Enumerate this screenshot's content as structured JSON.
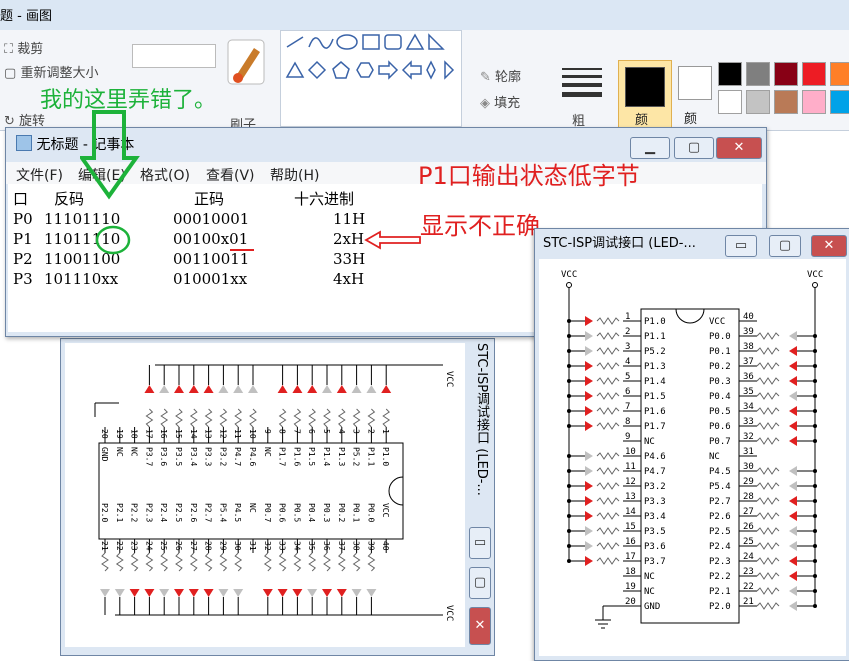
{
  "paint": {
    "title": "题 - 画图",
    "crop_label": "裁剪",
    "resize_label": "重新调整大小",
    "rotate_label": "旋转",
    "brush_label": "刷子",
    "outline_label": "轮廓",
    "fill_label": "填充",
    "size_label": "粗",
    "color1_label": "颜",
    "color2_label": "颜",
    "colors": [
      "#000000",
      "#7f7f7f",
      "#880015",
      "#ed1c24",
      "#ff7f27",
      "#ffffff",
      "#c3c3c3",
      "#b97a57",
      "#ffaec9",
      "#00a2e8"
    ]
  },
  "annotations": {
    "green_note": "我的这里弄错了。",
    "red_note_line1": "P1口输出状态低字节",
    "red_note_line2": "显示不正确"
  },
  "notepad": {
    "title": "无标题 - 记事本",
    "menu": [
      "文件(F)",
      "编辑(E)",
      "格式(O)",
      "查看(V)",
      "帮助(H)"
    ],
    "header": {
      "port": "口",
      "inverse": "反码",
      "normal": "正码",
      "hex": "十六进制"
    },
    "rows": [
      {
        "port": "P0",
        "inverse": "11101110",
        "normal": "00010001",
        "hex": "11H"
      },
      {
        "port": "P1",
        "inverse": "11011110",
        "normal": "00100x01",
        "hex": "2xH"
      },
      {
        "port": "P2",
        "inverse": "11001100",
        "normal": "00110011",
        "hex": "33H"
      },
      {
        "port": "P3",
        "inverse": "101110xx",
        "normal": "010001xx",
        "hex": "4xH"
      }
    ]
  },
  "bottom_window": {
    "title": "STC-ISP调试接口 (LED-...",
    "vcc": "VCC",
    "top_pins": [
      "20",
      "19",
      "18",
      "17",
      "16",
      "15",
      "14",
      "13",
      "12",
      "11",
      "10",
      "9",
      "8",
      "7",
      "6",
      "5",
      "4",
      "3",
      "2",
      "1"
    ],
    "top_labels": [
      "GND",
      "NC",
      "NC",
      "P3.7",
      "P3.6",
      "P3.5",
      "P3.4",
      "P3.3",
      "P3.2",
      "P4.7",
      "P4.6",
      "NC",
      "P1.7",
      "P1.6",
      "P1.5",
      "P1.4",
      "P1.3",
      "P5.2",
      "P1.1",
      "P1.0"
    ],
    "bottom_pins": [
      "21",
      "22",
      "23",
      "24",
      "25",
      "26",
      "27",
      "28",
      "29",
      "30",
      "31",
      "32",
      "33",
      "34",
      "35",
      "36",
      "37",
      "38",
      "39",
      "40"
    ],
    "bottom_labels": [
      "P2.0",
      "P2.1",
      "P2.2",
      "P2.3",
      "P2.4",
      "P2.5",
      "P2.6",
      "P2.7",
      "P5.4",
      "P4.5",
      "NC",
      "P0.7",
      "P0.6",
      "P0.5",
      "P0.4",
      "P0.3",
      "P0.2",
      "P0.1",
      "P0.0",
      "VCC"
    ]
  },
  "right_window": {
    "title": "STC-ISP调试接口 (LED-...",
    "vcc_left": "VCC",
    "vcc_right": "VCC",
    "left_pins": [
      "1",
      "2",
      "3",
      "4",
      "5",
      "6",
      "7",
      "8",
      "9",
      "10",
      "11",
      "12",
      "13",
      "14",
      "15",
      "16",
      "17",
      "18",
      "19",
      "20"
    ],
    "left_labels": [
      "P1.0",
      "P1.1",
      "P5.2",
      "P1.3",
      "P1.4",
      "P1.5",
      "P1.6",
      "P1.7",
      "NC",
      "P4.6",
      "P4.7",
      "P3.2",
      "P3.3",
      "P3.4",
      "P3.5",
      "P3.6",
      "P3.7",
      "NC",
      "NC",
      "GND"
    ],
    "right_pins": [
      "40",
      "39",
      "38",
      "37",
      "36",
      "35",
      "34",
      "33",
      "32",
      "31",
      "30",
      "29",
      "28",
      "27",
      "26",
      "25",
      "24",
      "23",
      "22",
      "21"
    ],
    "right_labels": [
      "VCC",
      "P0.0",
      "P0.1",
      "P0.2",
      "P0.3",
      "P0.4",
      "P0.5",
      "P0.6",
      "P0.7",
      "NC",
      "P4.5",
      "P5.4",
      "P2.7",
      "P2.6",
      "P2.5",
      "P2.4",
      "P2.3",
      "P2.2",
      "P2.1",
      "P2.0"
    ],
    "left_leds_on": [
      true,
      false,
      false,
      true,
      true,
      true,
      true,
      true,
      false,
      false,
      false,
      true,
      true,
      true,
      false,
      false,
      true
    ],
    "right_leds_on": [
      false,
      true,
      true,
      true,
      false,
      true,
      true,
      true,
      false,
      false,
      false,
      true,
      true,
      false,
      false,
      true,
      true,
      false,
      false
    ]
  },
  "bottom_leds_on_top": [
    false,
    false,
    true,
    false,
    true,
    true,
    true,
    false,
    false,
    false,
    false,
    true,
    true,
    true,
    false,
    true,
    false,
    false,
    true
  ],
  "bottom_leds_on_bottom": [
    false,
    false,
    true,
    true,
    false,
    true,
    true,
    true,
    false,
    false,
    false,
    true,
    true,
    true,
    false,
    true,
    true,
    false,
    false
  ]
}
